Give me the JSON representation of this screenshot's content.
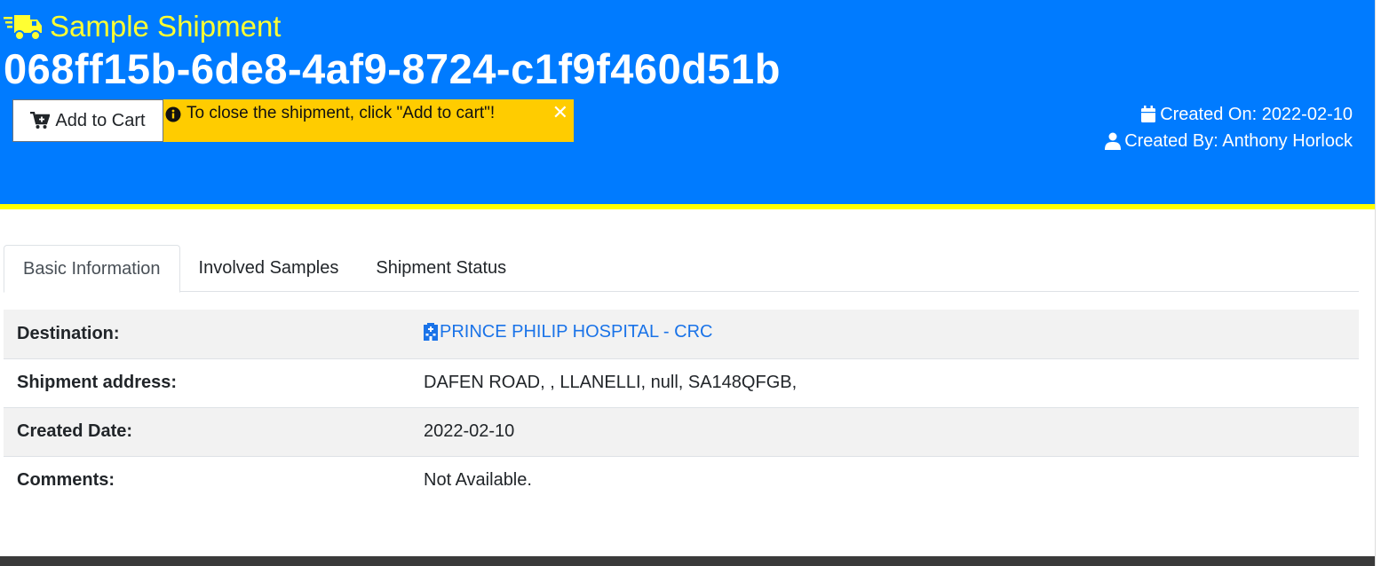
{
  "header": {
    "title": "Sample Shipment",
    "shipment_id": "068ff15b-6de8-4af9-8724-c1f9f460d51b",
    "title_icon": "truck-icon",
    "colors": {
      "background": "#007bff",
      "title": "#ffff33",
      "stripe": "#ffff00"
    }
  },
  "actions": {
    "add_to_cart_label": "Add to Cart",
    "add_to_cart_icon": "cart-plus-icon"
  },
  "alert": {
    "message": "To close the shipment, click \"Add to cart\"!",
    "icon": "info-icon",
    "close": "✕",
    "color": "#ffcc00"
  },
  "meta": {
    "created_on": "Created On: 2022-02-10",
    "created_by": "Created By: Anthony Horlock"
  },
  "tabs": [
    {
      "label": "Basic Information",
      "active": true
    },
    {
      "label": "Involved Samples",
      "active": false
    },
    {
      "label": "Shipment Status",
      "active": false
    }
  ],
  "details": [
    {
      "label": "Destination:",
      "value": "PRINCE PHILIP HOSPITAL - CRC",
      "icon": "hospital-icon"
    },
    {
      "label": "Shipment address:",
      "value": "DAFEN ROAD, , LLANELLI, null, SA148QFGB,"
    },
    {
      "label": "Created Date:",
      "value": "2022-02-10"
    },
    {
      "label": "Comments:",
      "value": "Not Available."
    }
  ]
}
